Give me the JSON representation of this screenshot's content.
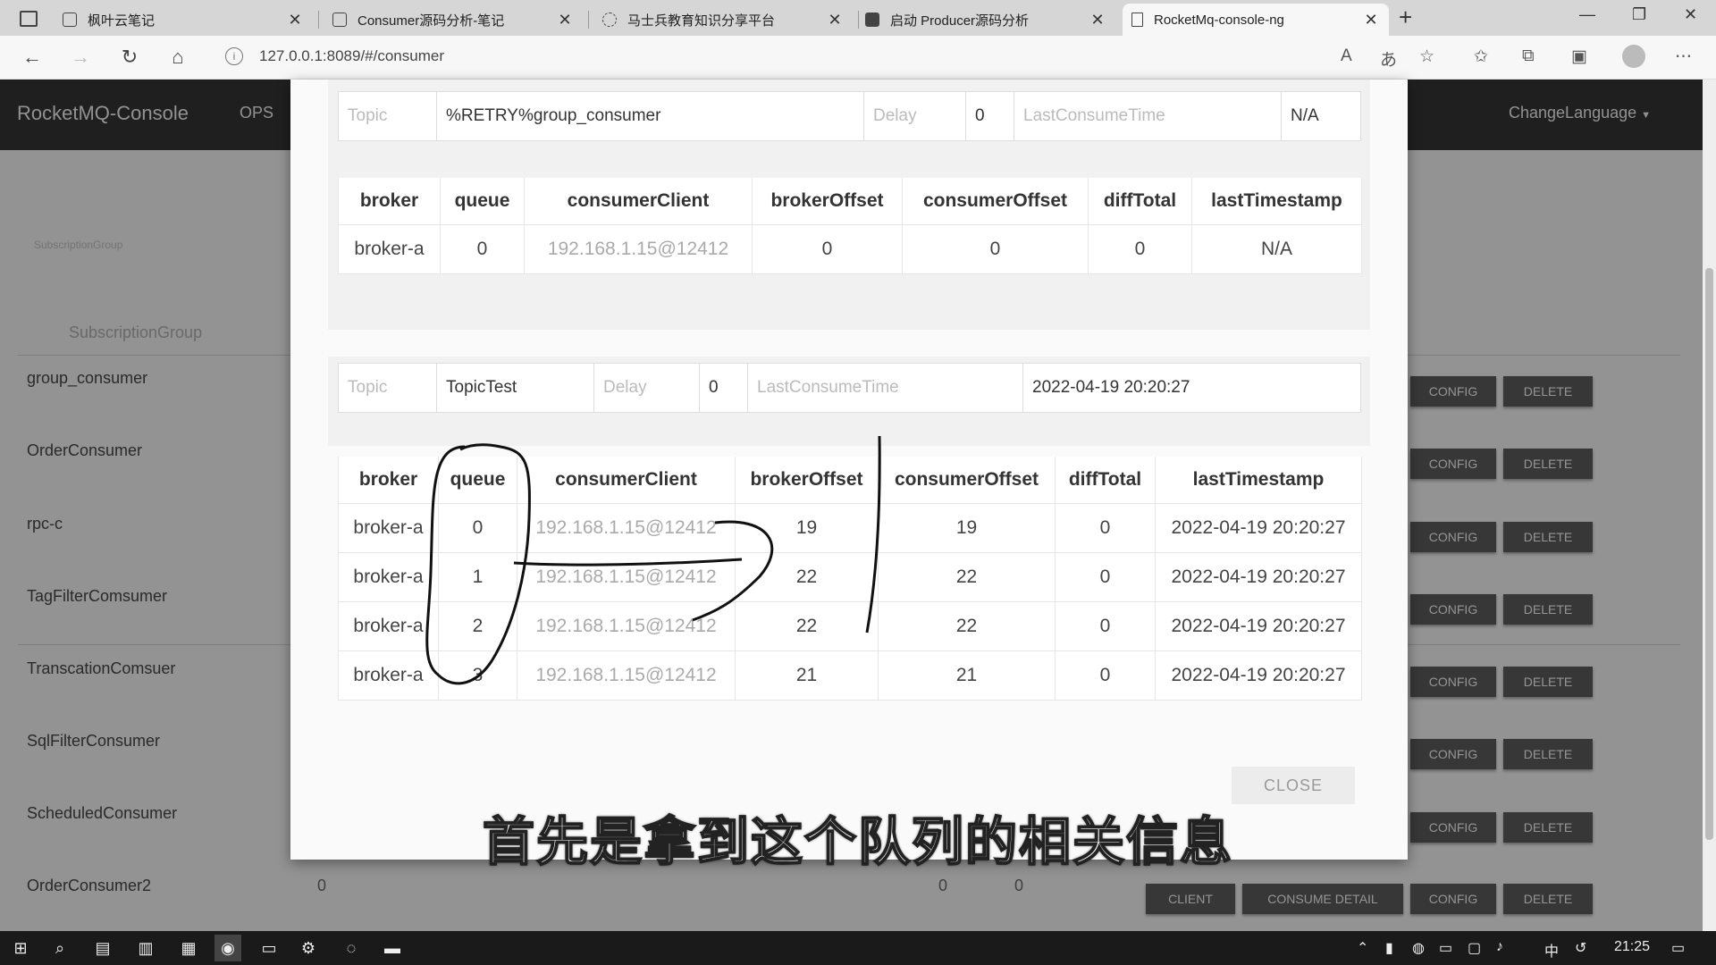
{
  "browser": {
    "tabs": [
      {
        "title": "枫叶云笔记"
      },
      {
        "title": "Consumer源码分析-笔记"
      },
      {
        "title": "马士兵教育知识分享平台"
      },
      {
        "title": "启动 Producer源码分析"
      },
      {
        "title": "RocketMq-console-ng"
      }
    ],
    "url": "127.0.0.1:8089/#/consumer"
  },
  "app": {
    "brand": "RocketMQ-Console",
    "nav_ops": "OPS",
    "change_language": "ChangeLanguage",
    "subscription_small": "SubscriptionGroup",
    "subscription_header": "SubscriptionGroup",
    "groups": [
      "group_consumer",
      "OrderConsumer",
      "rpc-c",
      "TagFilterComsumer",
      "TranscationComsuer",
      "SqlFilterConsumer",
      "ScheduledConsumer",
      "OrderConsumer2"
    ],
    "buttons": {
      "config": "CONFIG",
      "delete": "DELETE",
      "client": "CLIENT",
      "consume_detail": "CONSUME DETAIL"
    },
    "last_row_values": [
      "0",
      "0",
      "0"
    ]
  },
  "modal": {
    "labels": {
      "topic": "Topic",
      "delay": "Delay",
      "last_consume_time": "LastConsumeTime"
    },
    "columns": [
      "broker",
      "queue",
      "consumerClient",
      "brokerOffset",
      "consumerOffset",
      "diffTotal",
      "lastTimestamp"
    ],
    "sections": [
      {
        "topic": "%RETRY%group_consumer",
        "delay": "0",
        "last_consume_time": "N/A",
        "rows": [
          [
            "broker-a",
            "0",
            "192.168.1.15@12412",
            "0",
            "0",
            "0",
            "N/A"
          ]
        ]
      },
      {
        "topic": "TopicTest",
        "delay": "0",
        "last_consume_time": "2022-04-19 20:20:27",
        "rows": [
          [
            "broker-a",
            "0",
            "192.168.1.15@12412",
            "19",
            "19",
            "0",
            "2022-04-19 20:20:27"
          ],
          [
            "broker-a",
            "1",
            "192.168.1.15@12412",
            "22",
            "22",
            "0",
            "2022-04-19 20:20:27"
          ],
          [
            "broker-a",
            "2",
            "192.168.1.15@12412",
            "22",
            "22",
            "0",
            "2022-04-19 20:20:27"
          ],
          [
            "broker-a",
            "3",
            "192.168.1.15@12412",
            "21",
            "21",
            "0",
            "2022-04-19 20:20:27"
          ]
        ]
      }
    ],
    "close_label": "CLOSE"
  },
  "subtitle": "首先是拿到这个队列的相关信息",
  "taskbar": {
    "ime": "中",
    "time": "21:25"
  }
}
